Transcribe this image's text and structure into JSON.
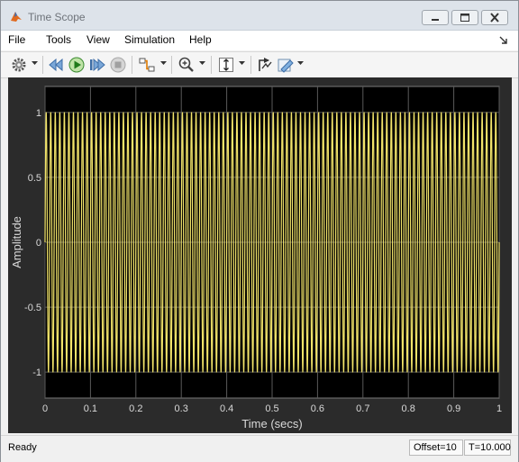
{
  "window": {
    "title": "Time Scope"
  },
  "menu": {
    "items": [
      "File",
      "Tools",
      "View",
      "Simulation",
      "Help"
    ]
  },
  "status": {
    "text": "Ready",
    "offset": "Offset=10",
    "time": "T=10.000"
  },
  "colors": {
    "signal": "#f2e46a",
    "axes_bg": "#000000",
    "panel_bg": "#2b2b2b",
    "grid": "#5a5a5a",
    "tick_text": "#d9d9d9"
  },
  "icons": [
    "settings-gear-icon",
    "step-back-icon",
    "run-icon",
    "step-forward-icon",
    "stop-icon",
    "signal-select-icon",
    "zoom-in-icon",
    "autoscale-icon",
    "restore-axes-icon",
    "style-icon"
  ],
  "chart_data": {
    "type": "line",
    "title": "",
    "xlabel": "Time (secs)",
    "ylabel": "Amplitude",
    "xlim": [
      0,
      1
    ],
    "ylim": [
      -1.2,
      1.2
    ],
    "xticks": [
      "0",
      "0.1",
      "0.2",
      "0.3",
      "0.4",
      "0.5",
      "0.6",
      "0.7",
      "0.8",
      "0.9",
      "1"
    ],
    "yticks": [
      "1",
      "0.5",
      "0",
      "-0.5",
      "-1"
    ],
    "grid": true,
    "series": [
      {
        "waveform": "sine",
        "amplitude": 1,
        "cycles_in_view": 100
      }
    ]
  }
}
